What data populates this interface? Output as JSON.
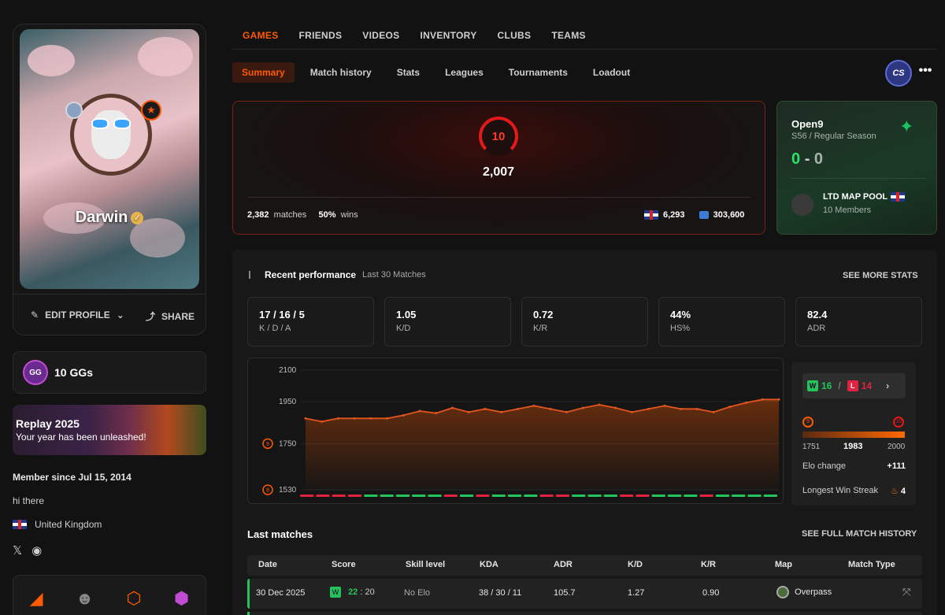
{
  "profile": {
    "name": "Darwin",
    "edit_label": "EDIT PROFILE",
    "share_label": "SHARE",
    "ggs_label": "10 GGs",
    "gg_icon_text": "GG",
    "replay_title": "Replay 2025",
    "replay_sub": "Your year has been unleashed!",
    "member_since": "Member since Jul 15, 2014",
    "bio": "hi there",
    "country": "United Kingdom"
  },
  "nav": {
    "tabs": [
      "GAMES",
      "FRIENDS",
      "VIDEOS",
      "INVENTORY",
      "CLUBS",
      "TEAMS"
    ],
    "active_tab": "GAMES",
    "subtabs": [
      "Summary",
      "Match history",
      "Stats",
      "Leagues",
      "Tournaments",
      "Loadout"
    ],
    "active_subtab": "Summary",
    "game_badge": "CS",
    "more": "•••"
  },
  "elo": {
    "level": "10",
    "value": "2,007",
    "matches_count": "2,382",
    "matches_label": "matches",
    "win_pct": "50%",
    "wins_label": "wins",
    "country_rank": "6,293",
    "region_rank": "303,600"
  },
  "league": {
    "name": "Open9",
    "season": "S56 / Regular Season",
    "score_w": "0",
    "score_sep": "-",
    "score_l": "0",
    "club_name": "LTD MAP POOL",
    "club_members": "10 Members"
  },
  "performance": {
    "title": "Recent performance",
    "subtitle": "Last 30 Matches",
    "see_more": "SEE MORE STATS",
    "stats": [
      {
        "value": "17 / 16 / 5",
        "label": "K / D / A"
      },
      {
        "value": "1.05",
        "label": "K/D"
      },
      {
        "value": "0.72",
        "label": "K/R"
      },
      {
        "value": "44%",
        "label": "HS%"
      },
      {
        "value": "82.4",
        "label": "ADR"
      }
    ],
    "wins": "16",
    "losses": "14",
    "w_letter": "W",
    "l_letter": "L",
    "range_min": "1751",
    "range_current": "1983",
    "range_max": "2000",
    "level_min": "9",
    "level_max": "10",
    "elo_change_label": "Elo change",
    "elo_change": "+111",
    "streak_label": "Longest Win Streak",
    "streak": "4"
  },
  "chart_data": {
    "type": "line",
    "title": "",
    "xlabel": "",
    "ylabel": "",
    "ylim": [
      1530,
      2100
    ],
    "yticks": [
      "2100",
      "1950",
      "1750",
      "1530"
    ],
    "ytick_level_markers": [
      "9",
      "8"
    ],
    "x": [
      1,
      2,
      3,
      4,
      5,
      6,
      7,
      8,
      9,
      10,
      11,
      12,
      13,
      14,
      15,
      16,
      17,
      18,
      19,
      20,
      21,
      22,
      23,
      24,
      25,
      26,
      27,
      28,
      29,
      30
    ],
    "series": [
      {
        "values": [
          1870,
          1855,
          1870,
          1870,
          1870,
          1870,
          1885,
          1905,
          1895,
          1920,
          1900,
          1915,
          1900,
          1915,
          1930,
          1915,
          1900,
          1920,
          1935,
          1920,
          1900,
          1915,
          1930,
          1915,
          1915,
          1900,
          1925,
          1945,
          1960,
          1960
        ]
      }
    ],
    "results": [
      "L",
      "L",
      "L",
      "L",
      "W",
      "W",
      "W",
      "W",
      "W",
      "L",
      "W",
      "L",
      "W",
      "W",
      "W",
      "L",
      "L",
      "W",
      "W",
      "W",
      "L",
      "L",
      "W",
      "W",
      "W",
      "L",
      "W",
      "W",
      "W",
      "W"
    ]
  },
  "last_matches": {
    "title": "Last matches",
    "see_full": "SEE FULL MATCH HISTORY",
    "columns": [
      "Date",
      "Score",
      "Skill level",
      "KDA",
      "ADR",
      "K/D",
      "K/R",
      "Map",
      "Match Type"
    ],
    "rows": [
      {
        "date": "30 Dec 2025",
        "result": "W",
        "score_own": "22",
        "score_sep": ":",
        "score_opp": "20",
        "skill": "No Elo",
        "kda": "38 / 30 / 11",
        "adr": "105.7",
        "kd": "1.27",
        "kr": "0.90",
        "map": "Overpass"
      }
    ]
  },
  "colors": {
    "accent": "#ff5a00",
    "win": "#23c55a",
    "loss": "#e22340",
    "bg": "#121212"
  }
}
